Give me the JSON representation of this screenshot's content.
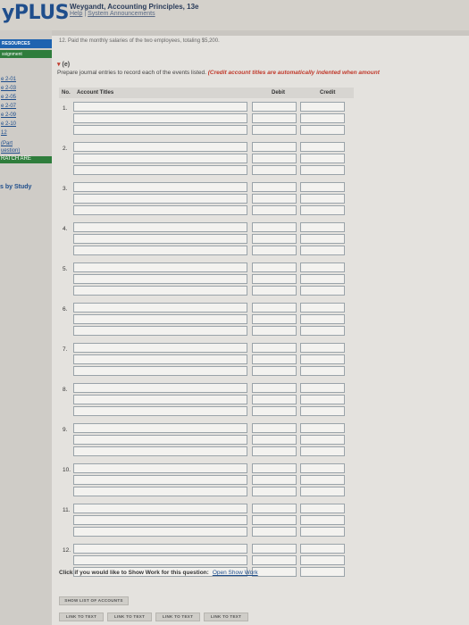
{
  "header": {
    "logo": "yPLUS",
    "book_title": "Weygandt, Accounting Principles, 13e",
    "help_link": "Help",
    "announcements_link": "System Announcements"
  },
  "sidebar": {
    "resources_label": "RESOURCES",
    "assignment_label": "ssignment",
    "items": [
      "e 2-01",
      "e 2-03",
      "e 2-05",
      "e 2-07",
      "e 2-09",
      "e 2-10",
      "12"
    ],
    "part_link": "(Part",
    "part_link2": "uestion)",
    "scratch_link": "RATCH ARE",
    "study_link": "s by Study"
  },
  "problem_text": "12.  Paid the monthly salaries of the two employees, totaling $5,200.",
  "part": {
    "marker": "▾",
    "label": "(e)"
  },
  "instructions": {
    "text": "Prepare journal entries to record each of the events listed. ",
    "note": "(Credit account titles are automatically indented when amount"
  },
  "table_headers": {
    "no": "No.",
    "account": "Account Titles",
    "debit": "Debit",
    "credit": "Credit"
  },
  "entries": [
    "1.",
    "2.",
    "3.",
    "4.",
    "5.",
    "6.",
    "7.",
    "8.",
    "9.",
    "10.",
    "11.",
    "12."
  ],
  "show_work": {
    "label": "Click if you would like to Show Work for this question:",
    "link": "Open Show Work"
  },
  "buttons": {
    "show_list": "SHOW LIST OF ACCOUNTS",
    "links": [
      "LINK TO TEXT",
      "LINK TO TEXT",
      "LINK TO TEXT",
      "LINK TO TEXT"
    ]
  }
}
